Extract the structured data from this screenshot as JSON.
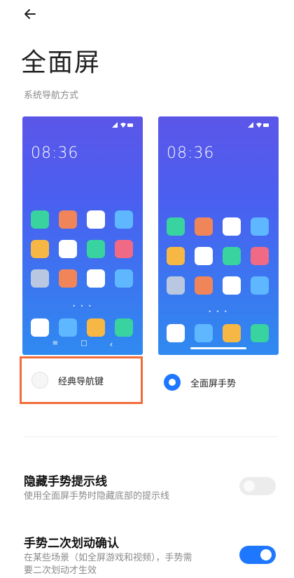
{
  "header": {
    "back_icon": "back-arrow-icon",
    "title": "全面屏"
  },
  "section": {
    "label": "系统导航方式"
  },
  "previews": {
    "clock": "08:36",
    "nav_keys": [
      "≡",
      "□",
      "‹"
    ],
    "page_dots": "• • •"
  },
  "options": {
    "classic": {
      "label": "经典导航键",
      "selected": false
    },
    "gesture": {
      "label": "全面屏手势",
      "selected": true
    }
  },
  "settings": [
    {
      "title": "隐藏手势提示线",
      "desc": "使用全面屏手势时隐藏底部的提示线",
      "enabled": false
    },
    {
      "title": "手势二次划动确认",
      "desc_line1": "在某些场景（如全屏游戏和视频），手势需",
      "desc_line2": "要二次划动才生效",
      "enabled": true
    }
  ],
  "colors": {
    "accent": "#1e78ff",
    "highlight_box": "#f26b3a",
    "app_green": "#38d39f",
    "app_orange": "#f0855a",
    "app_white": "#ffffff",
    "app_blue": "#5fb8ff",
    "app_yellow": "#f7b744",
    "app_red": "#f06a86",
    "app_gray": "#b9c7e0"
  }
}
